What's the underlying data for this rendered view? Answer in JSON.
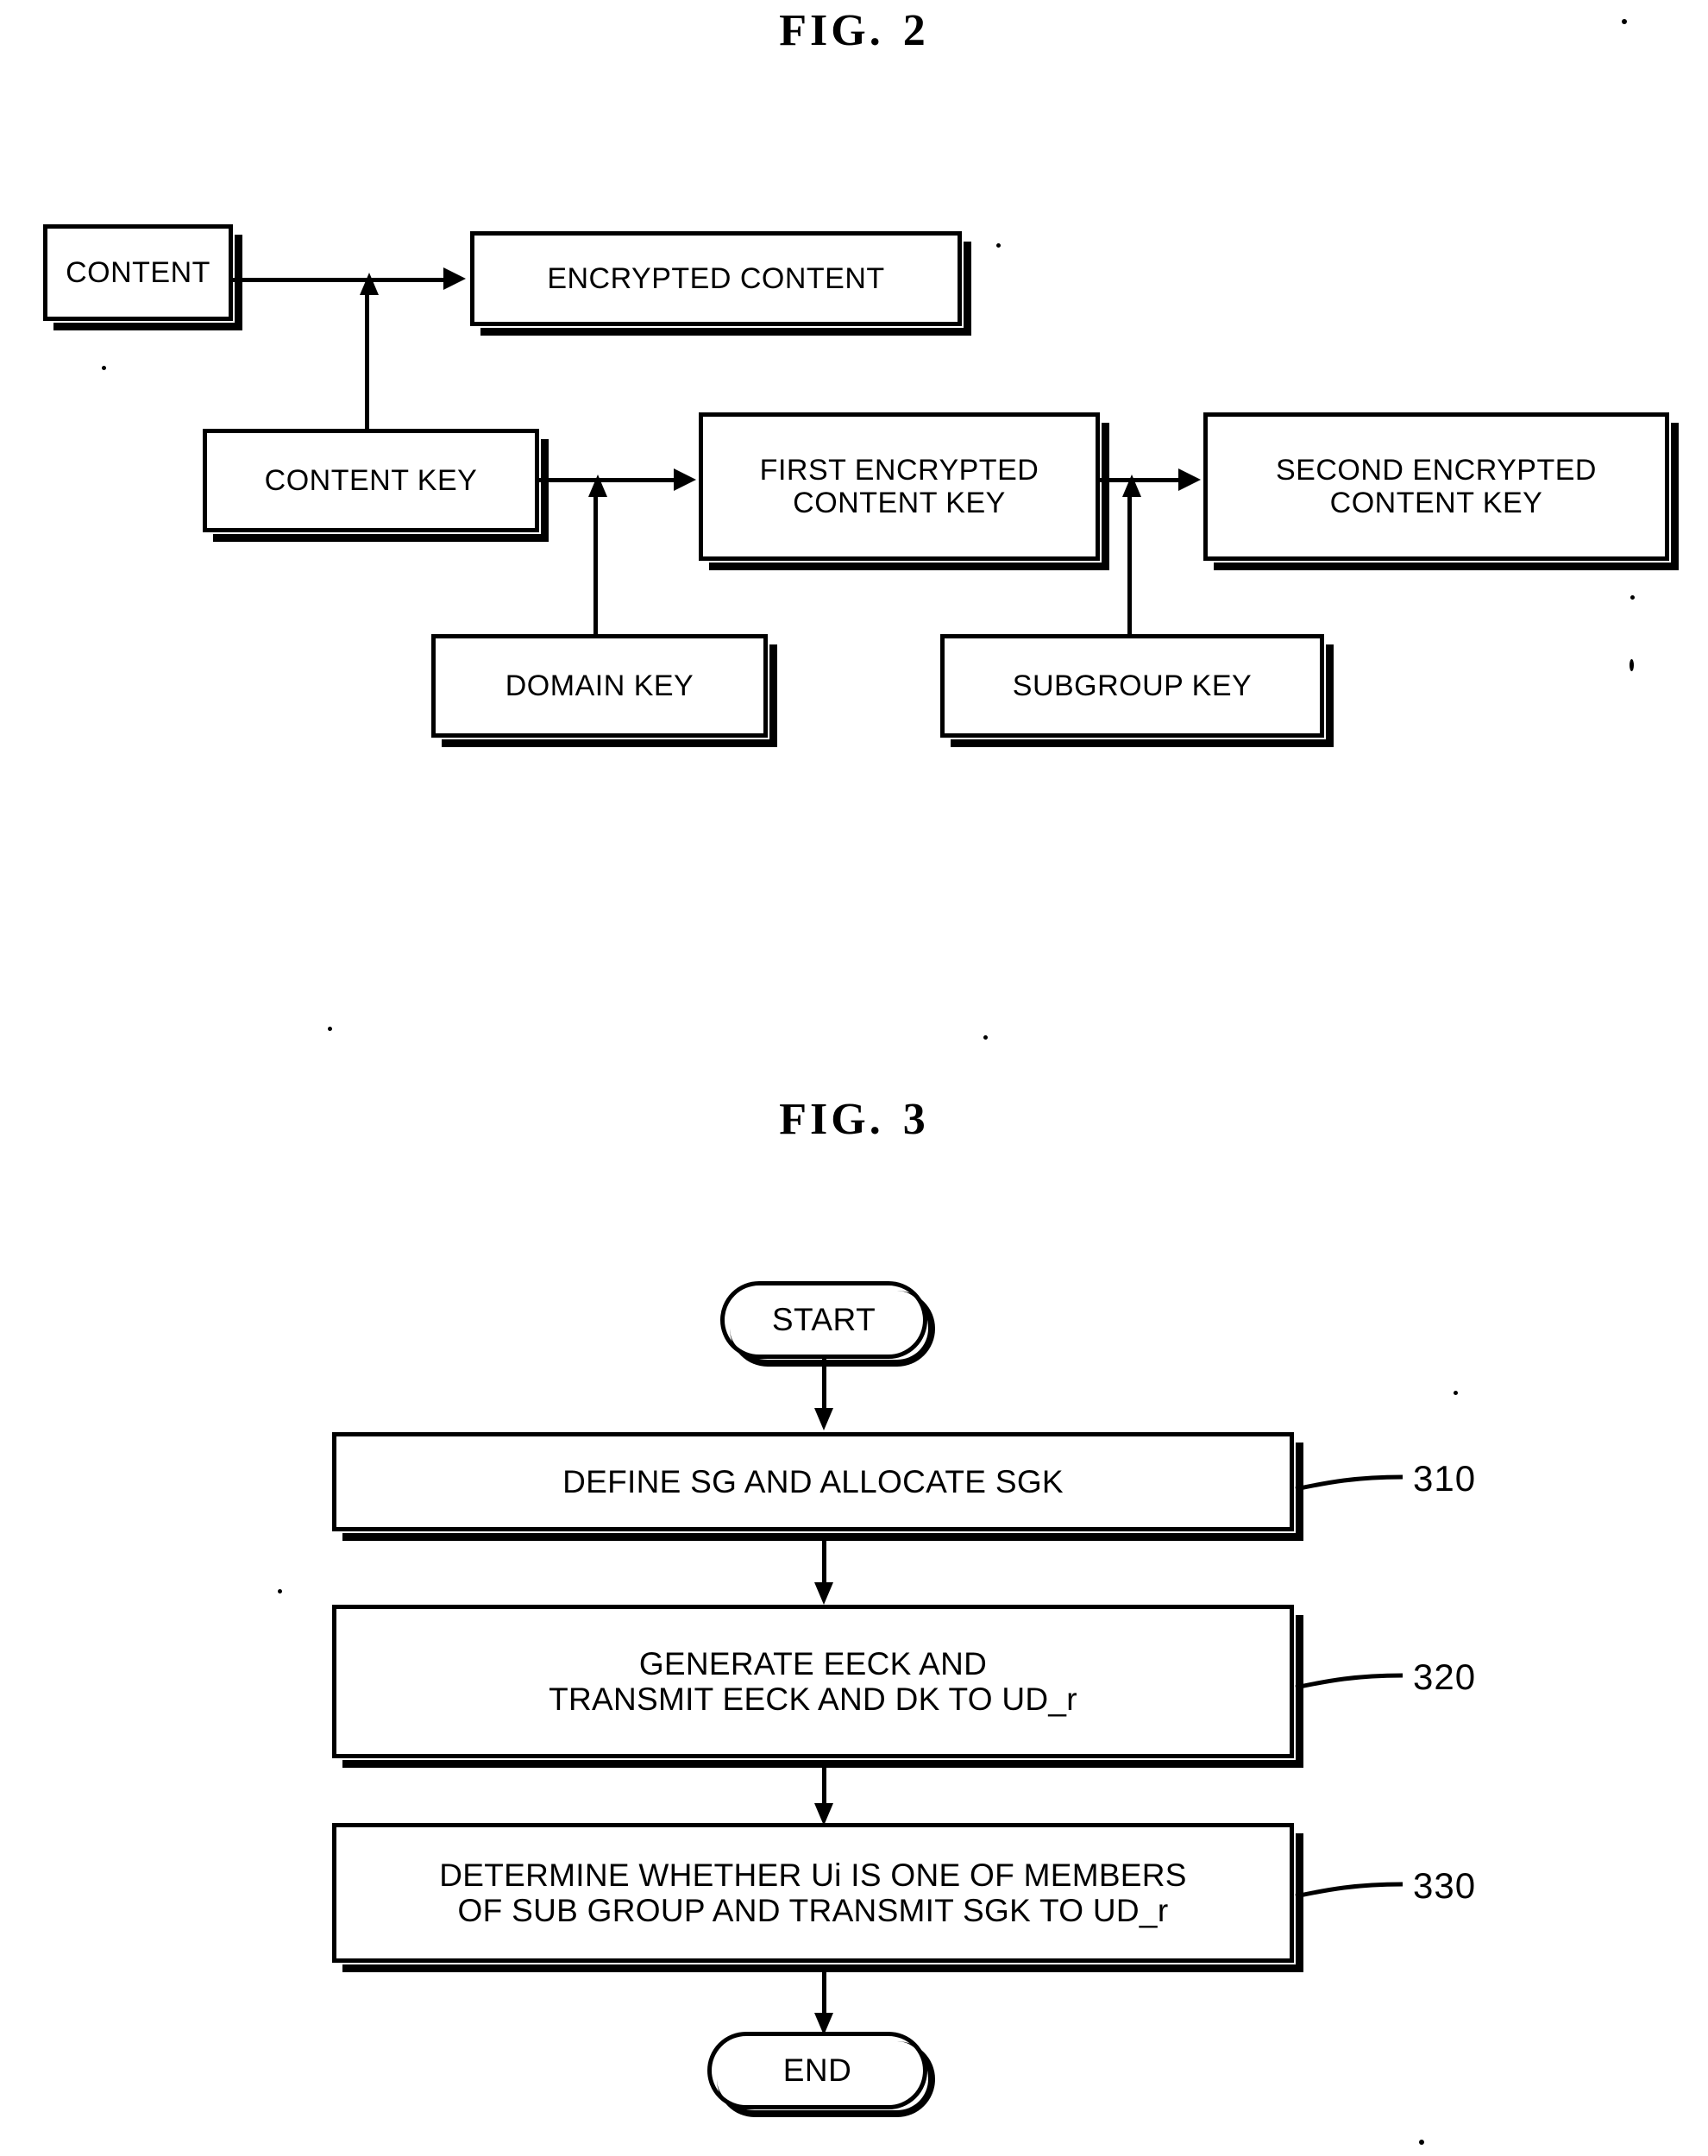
{
  "figures": [
    {
      "id": "fig2",
      "title_prefix": "FIG.",
      "title_number": "2",
      "type": "block-diagram",
      "blocks": [
        {
          "key": "content",
          "label": "CONTENT"
        },
        {
          "key": "encrypted_content",
          "label": "ENCRYPTED CONTENT"
        },
        {
          "key": "content_key",
          "label": "CONTENT KEY"
        },
        {
          "key": "first_eck",
          "line1": "FIRST ENCRYPTED",
          "line2": "CONTENT KEY"
        },
        {
          "key": "second_eck",
          "line1": "SECOND ENCRYPTED",
          "line2": "CONTENT KEY"
        },
        {
          "key": "domain_key",
          "label": "DOMAIN KEY"
        },
        {
          "key": "subgroup_key",
          "label": "SUBGROUP KEY"
        }
      ],
      "edges": [
        {
          "from": "content",
          "to": "encrypted_content",
          "direction": "right"
        },
        {
          "from": "content_key",
          "to": "encrypted_content",
          "direction": "up"
        },
        {
          "from": "content_key",
          "to": "first_eck",
          "direction": "right"
        },
        {
          "from": "domain_key",
          "to": "first_eck",
          "direction": "up"
        },
        {
          "from": "first_eck",
          "to": "second_eck",
          "direction": "right"
        },
        {
          "from": "subgroup_key",
          "to": "second_eck",
          "direction": "up"
        }
      ]
    },
    {
      "id": "fig3",
      "title_prefix": "FIG.",
      "title_number": "3",
      "type": "flowchart",
      "start_label": "START",
      "end_label": "END",
      "steps": [
        {
          "ref": "310",
          "line1": "DEFINE SG AND ALLOCATE SGK",
          "line2": ""
        },
        {
          "ref": "320",
          "line1": "GENERATE EECK AND",
          "line2": "TRANSMIT EECK AND DK TO UD_r"
        },
        {
          "ref": "330",
          "line1": "DETERMINE WHETHER Ui IS ONE OF MEMBERS",
          "line2": "OF SUB GROUP AND TRANSMIT SGK TO UD_r"
        }
      ]
    }
  ],
  "colors": {
    "ink": "#000000",
    "paper": "#ffffff"
  }
}
